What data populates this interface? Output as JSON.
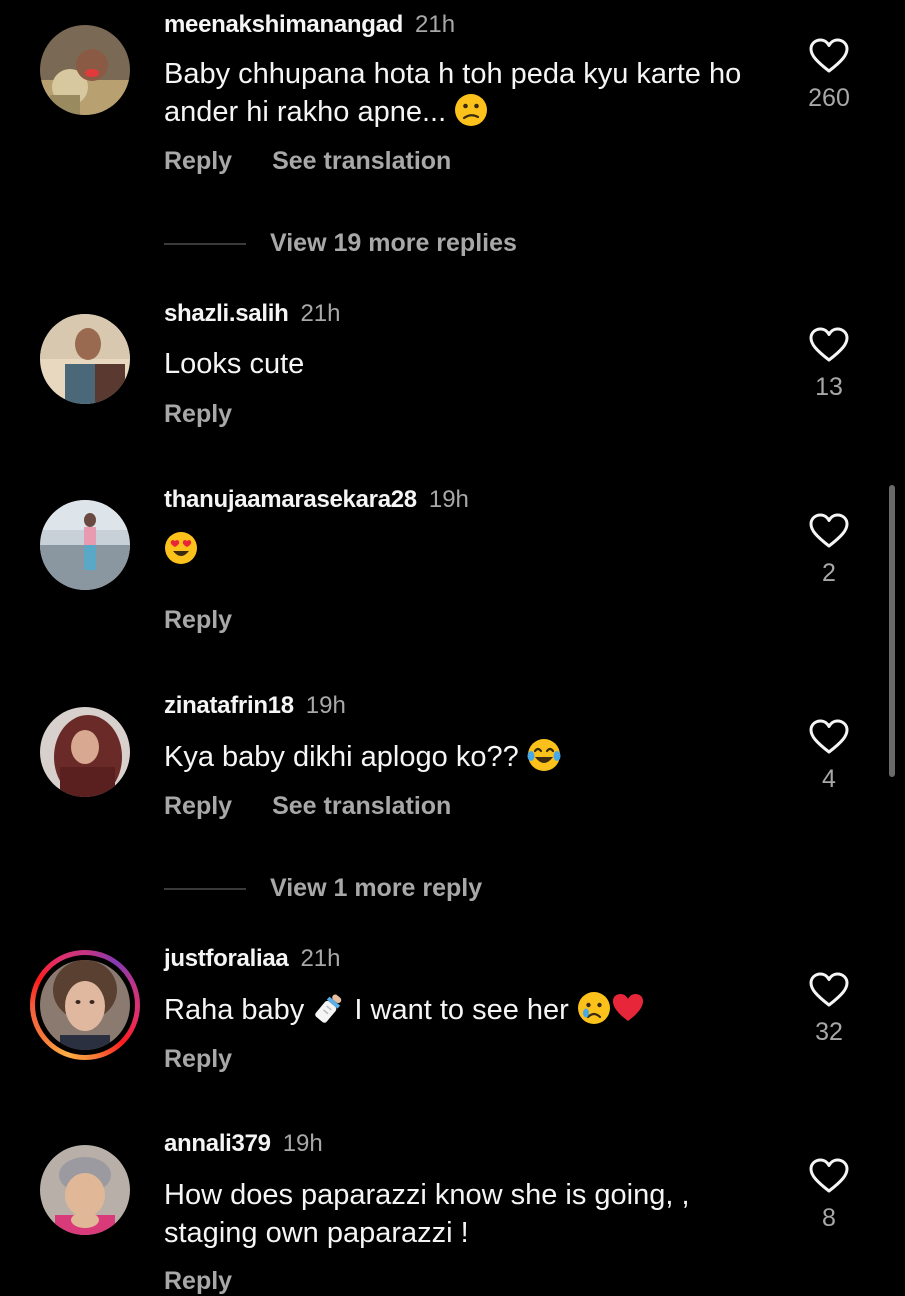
{
  "comments": [
    {
      "username": "meenakshimanangad",
      "time": "21h",
      "text": "Baby chhupana hota h toh peda kyu karte ho ander hi rakho apne...",
      "reply_label": "Reply",
      "translate_label": "See translation",
      "like_count": "260",
      "emoji_icon": "confused-face-emoji"
    },
    {
      "username": "shazli.salih",
      "time": "21h",
      "text": "Looks cute",
      "reply_label": "Reply",
      "like_count": "13"
    },
    {
      "username": "thanujaamarasekara28",
      "time": "19h",
      "text": "",
      "reply_label": "Reply",
      "like_count": "2",
      "emoji_icon": "heart-eyes-emoji"
    },
    {
      "username": "zinatafrin18",
      "time": "19h",
      "text": "Kya baby dikhi aplogo ko??",
      "reply_label": "Reply",
      "translate_label": "See translation",
      "like_count": "4",
      "emoji_icon": "tears-of-joy-emoji"
    },
    {
      "username": "justforaliaa",
      "time": "21h",
      "text_before": "Raha baby",
      "text_after": "I want to see her",
      "reply_label": "Reply",
      "like_count": "32",
      "has_story_ring": true,
      "emoji_icons": [
        "baby-bottle-emoji",
        "crying-face-emoji",
        "red-heart-emoji"
      ]
    },
    {
      "username": "annali379",
      "time": "19h",
      "text": "How does paparazzi know she is going, , staging own paparazzi !",
      "reply_label": "Reply",
      "like_count": "8"
    }
  ],
  "view_replies": [
    {
      "label": "View 19 more replies"
    },
    {
      "label": "View 1 more reply"
    }
  ],
  "colors": {
    "background": "#000000",
    "primary_text": "#f5f5f5",
    "secondary_text": "#a8a8a8",
    "story_ring_start": "#fcaf45",
    "story_ring_end": "#c13584"
  }
}
